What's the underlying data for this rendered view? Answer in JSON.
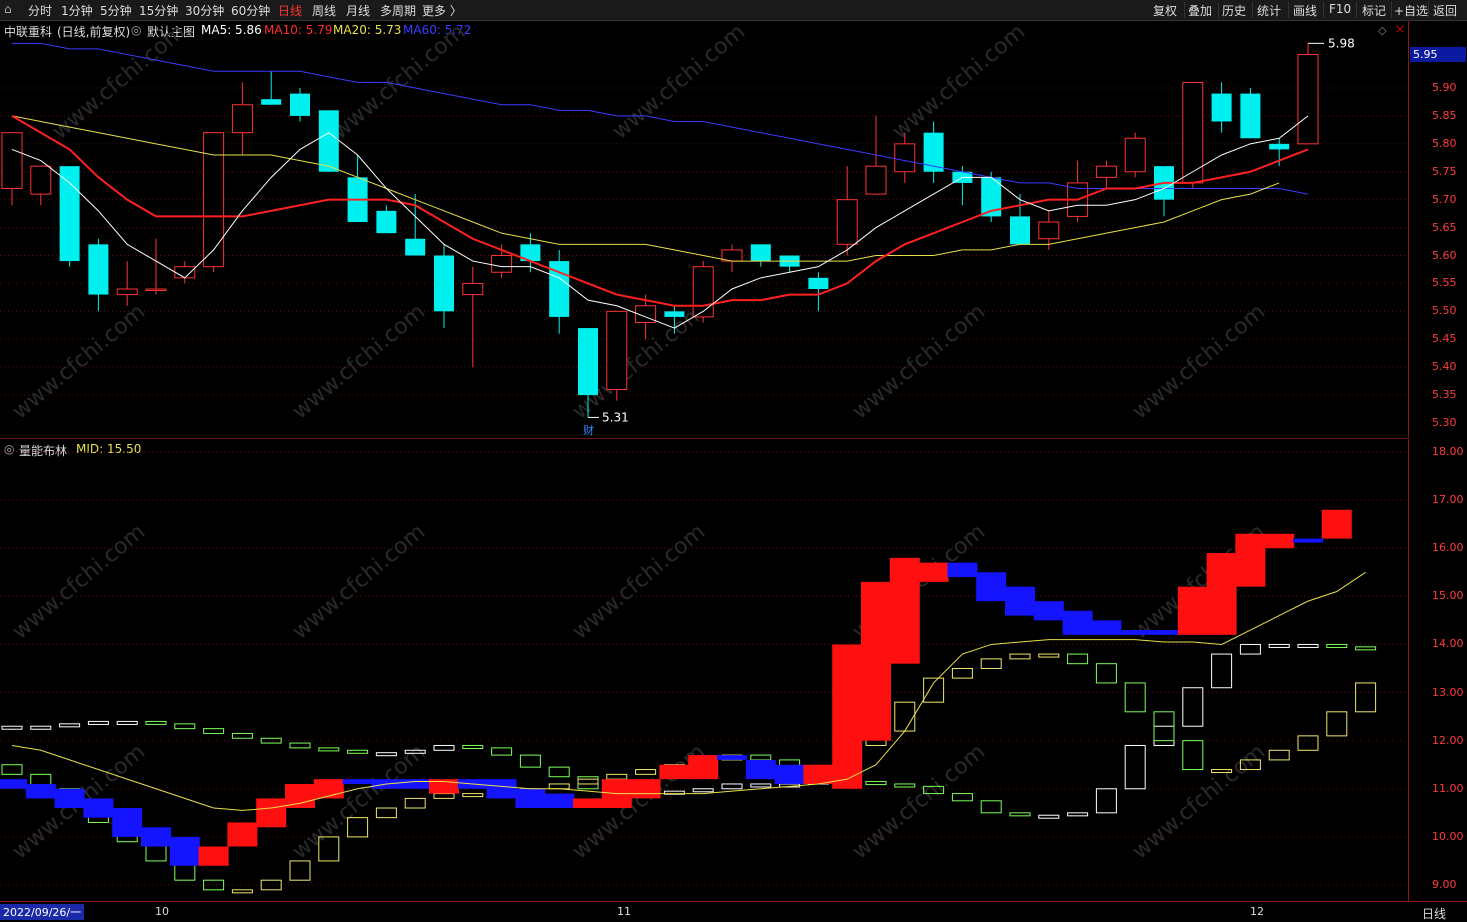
{
  "toolbar": {
    "left_items": [
      "分时",
      "1分钟",
      "5分钟",
      "15分钟",
      "30分钟",
      "60分钟",
      "日线",
      "周线",
      "月线",
      "多周期",
      "更多 〉"
    ],
    "active": "日线",
    "right_items": [
      "复权",
      "叠加",
      "历史",
      "统计",
      "画线",
      "F10",
      "标记",
      "+自选",
      "返回"
    ]
  },
  "main_info": {
    "stock": "中联重科",
    "mode": "(日线,前复权)",
    "template": "默认主图",
    "ma5": "MA5: 5.86",
    "ma10": "MA10: 5.79",
    "ma20": "MA20: 5.73",
    "ma60": "MA60: 5.72",
    "colors": {
      "ma5": "#ffffff",
      "ma10": "#ff2a2a",
      "ma20": "#e8e04a",
      "ma60": "#3b3bff"
    }
  },
  "current_price_tag": "5.95",
  "annotations": {
    "high": "5.98",
    "low": "5.31",
    "badge": "财"
  },
  "price_axis": [
    "5.90",
    "5.85",
    "5.80",
    "5.75",
    "5.70",
    "5.65",
    "5.60",
    "5.55",
    "5.50",
    "5.45",
    "5.40",
    "5.35",
    "5.30"
  ],
  "indicator_info": {
    "name": "量能布林",
    "mid": "MID: 15.50"
  },
  "indicator_axis": [
    "18.00",
    "17.00",
    "16.00",
    "15.00",
    "14.00",
    "13.00",
    "12.00",
    "11.00",
    "10.00",
    "9.00"
  ],
  "date_bar": {
    "start": "2022/09/26/一",
    "m10": "10",
    "m11": "11",
    "m12": "12",
    "period": "日线"
  },
  "candles": [
    {
      "o": 5.72,
      "h": 5.82,
      "l": 5.69,
      "c": 5.82
    },
    {
      "o": 5.71,
      "h": 5.76,
      "l": 5.69,
      "c": 5.76
    },
    {
      "o": 5.76,
      "h": 5.76,
      "l": 5.58,
      "c": 5.59
    },
    {
      "o": 5.62,
      "h": 5.63,
      "l": 5.5,
      "c": 5.53
    },
    {
      "o": 5.53,
      "h": 5.59,
      "l": 5.51,
      "c": 5.54
    },
    {
      "o": 5.54,
      "h": 5.63,
      "l": 5.53,
      "c": 5.54
    },
    {
      "o": 5.56,
      "h": 5.59,
      "l": 5.55,
      "c": 5.58
    },
    {
      "o": 5.58,
      "h": 5.82,
      "l": 5.57,
      "c": 5.82
    },
    {
      "o": 5.82,
      "h": 5.91,
      "l": 5.78,
      "c": 5.87
    },
    {
      "o": 5.88,
      "h": 5.93,
      "l": 5.87,
      "c": 5.87
    },
    {
      "o": 5.89,
      "h": 5.9,
      "l": 5.84,
      "c": 5.85
    },
    {
      "o": 5.86,
      "h": 5.86,
      "l": 5.75,
      "c": 5.75
    },
    {
      "o": 5.74,
      "h": 5.78,
      "l": 5.66,
      "c": 5.66
    },
    {
      "o": 5.68,
      "h": 5.69,
      "l": 5.64,
      "c": 5.64
    },
    {
      "o": 5.63,
      "h": 5.71,
      "l": 5.6,
      "c": 5.6
    },
    {
      "o": 5.6,
      "h": 5.62,
      "l": 5.47,
      "c": 5.5
    },
    {
      "o": 5.53,
      "h": 5.58,
      "l": 5.4,
      "c": 5.55
    },
    {
      "o": 5.57,
      "h": 5.62,
      "l": 5.56,
      "c": 5.6
    },
    {
      "o": 5.62,
      "h": 5.64,
      "l": 5.57,
      "c": 5.59
    },
    {
      "o": 5.59,
      "h": 5.61,
      "l": 5.46,
      "c": 5.49
    },
    {
      "o": 5.47,
      "h": 5.47,
      "l": 5.31,
      "c": 5.35
    },
    {
      "o": 5.36,
      "h": 5.5,
      "l": 5.34,
      "c": 5.5
    },
    {
      "o": 5.48,
      "h": 5.53,
      "l": 5.45,
      "c": 5.51
    },
    {
      "o": 5.5,
      "h": 5.51,
      "l": 5.46,
      "c": 5.49
    },
    {
      "o": 5.49,
      "h": 5.59,
      "l": 5.48,
      "c": 5.58
    },
    {
      "o": 5.59,
      "h": 5.62,
      "l": 5.57,
      "c": 5.61
    },
    {
      "o": 5.62,
      "h": 5.62,
      "l": 5.58,
      "c": 5.59
    },
    {
      "o": 5.6,
      "h": 5.6,
      "l": 5.57,
      "c": 5.58
    },
    {
      "o": 5.56,
      "h": 5.57,
      "l": 5.5,
      "c": 5.54
    },
    {
      "o": 5.62,
      "h": 5.76,
      "l": 5.6,
      "c": 5.7
    },
    {
      "o": 5.71,
      "h": 5.85,
      "l": 5.71,
      "c": 5.76
    },
    {
      "o": 5.75,
      "h": 5.82,
      "l": 5.73,
      "c": 5.8
    },
    {
      "o": 5.82,
      "h": 5.84,
      "l": 5.73,
      "c": 5.75
    },
    {
      "o": 5.75,
      "h": 5.76,
      "l": 5.69,
      "c": 5.73
    },
    {
      "o": 5.74,
      "h": 5.75,
      "l": 5.66,
      "c": 5.67
    },
    {
      "o": 5.67,
      "h": 5.71,
      "l": 5.62,
      "c": 5.62
    },
    {
      "o": 5.63,
      "h": 5.68,
      "l": 5.61,
      "c": 5.66
    },
    {
      "o": 5.67,
      "h": 5.77,
      "l": 5.66,
      "c": 5.73
    },
    {
      "o": 5.74,
      "h": 5.77,
      "l": 5.72,
      "c": 5.76
    },
    {
      "o": 5.75,
      "h": 5.82,
      "l": 5.74,
      "c": 5.81
    },
    {
      "o": 5.76,
      "h": 5.76,
      "l": 5.67,
      "c": 5.7
    },
    {
      "o": 5.73,
      "h": 5.91,
      "l": 5.72,
      "c": 5.91
    },
    {
      "o": 5.89,
      "h": 5.91,
      "l": 5.82,
      "c": 5.84
    },
    {
      "o": 5.89,
      "h": 5.9,
      "l": 5.81,
      "c": 5.81
    },
    {
      "o": 5.8,
      "h": 5.81,
      "l": 5.76,
      "c": 5.79
    },
    {
      "o": 5.8,
      "h": 5.98,
      "l": 5.8,
      "c": 5.96
    }
  ],
  "ma5": [
    5.79,
    5.77,
    5.73,
    5.68,
    5.62,
    5.59,
    5.56,
    5.61,
    5.68,
    5.74,
    5.79,
    5.82,
    5.78,
    5.72,
    5.67,
    5.62,
    5.59,
    5.58,
    5.58,
    5.56,
    5.52,
    5.51,
    5.49,
    5.47,
    5.5,
    5.54,
    5.56,
    5.57,
    5.58,
    5.61,
    5.65,
    5.68,
    5.71,
    5.74,
    5.74,
    5.7,
    5.68,
    5.69,
    5.69,
    5.7,
    5.72,
    5.75,
    5.78,
    5.8,
    5.81,
    5.85
  ],
  "ma10": [
    5.85,
    5.82,
    5.79,
    5.74,
    5.7,
    5.67,
    5.67,
    5.67,
    5.67,
    5.68,
    5.69,
    5.7,
    5.7,
    5.7,
    5.69,
    5.66,
    5.63,
    5.61,
    5.59,
    5.57,
    5.55,
    5.53,
    5.52,
    5.51,
    5.51,
    5.52,
    5.52,
    5.53,
    5.53,
    5.55,
    5.59,
    5.62,
    5.64,
    5.66,
    5.68,
    5.69,
    5.7,
    5.7,
    5.72,
    5.72,
    5.73,
    5.73,
    5.74,
    5.75,
    5.77,
    5.79
  ],
  "ma20": [
    5.85,
    5.84,
    5.83,
    5.82,
    5.81,
    5.8,
    5.79,
    5.78,
    5.78,
    5.78,
    5.77,
    5.76,
    5.74,
    5.72,
    5.7,
    5.68,
    5.66,
    5.64,
    5.63,
    5.62,
    5.62,
    5.62,
    5.62,
    5.61,
    5.6,
    5.59,
    5.59,
    5.59,
    5.59,
    5.59,
    5.6,
    5.6,
    5.6,
    5.61,
    5.61,
    5.62,
    5.62,
    5.63,
    5.64,
    5.65,
    5.66,
    5.68,
    5.7,
    5.71,
    5.73
  ],
  "ma60": [
    5.98,
    5.98,
    5.97,
    5.97,
    5.96,
    5.95,
    5.94,
    5.93,
    5.93,
    5.93,
    5.93,
    5.92,
    5.91,
    5.91,
    5.9,
    5.89,
    5.88,
    5.87,
    5.87,
    5.86,
    5.86,
    5.85,
    5.85,
    5.84,
    5.84,
    5.83,
    5.82,
    5.81,
    5.8,
    5.79,
    5.78,
    5.77,
    5.76,
    5.75,
    5.74,
    5.73,
    5.73,
    5.72,
    5.72,
    5.72,
    5.72,
    5.72,
    5.72,
    5.72,
    5.72,
    5.71
  ],
  "ind_boxes": [
    {
      "a": 11.2,
      "b": 11.0,
      "c": "blue"
    },
    {
      "a": 11.1,
      "b": 10.8,
      "c": "blue"
    },
    {
      "a": 11.0,
      "b": 10.6,
      "c": "blue"
    },
    {
      "a": 10.8,
      "b": 10.4,
      "c": "blue"
    },
    {
      "a": 10.6,
      "b": 10.0,
      "c": "blue"
    },
    {
      "a": 10.2,
      "b": 9.8,
      "c": "blue"
    },
    {
      "a": 10.0,
      "b": 9.4,
      "c": "blue"
    },
    {
      "a": 9.8,
      "b": 9.4,
      "c": "red"
    },
    {
      "a": 9.8,
      "b": 10.3,
      "c": "red"
    },
    {
      "a": 10.2,
      "b": 10.8,
      "c": "red"
    },
    {
      "a": 10.6,
      "b": 11.1,
      "c": "red"
    },
    {
      "a": 10.8,
      "b": 11.2,
      "c": "red"
    },
    {
      "a": 11.2,
      "b": 11.1,
      "c": "blue"
    },
    {
      "a": 11.2,
      "b": 11.0,
      "c": "blue"
    },
    {
      "a": 11.2,
      "b": 11.0,
      "c": "blue"
    },
    {
      "a": 11.2,
      "b": 10.9,
      "c": "red"
    },
    {
      "a": 11.2,
      "b": 11.0,
      "c": "blue"
    },
    {
      "a": 11.2,
      "b": 10.8,
      "c": "blue"
    },
    {
      "a": 11.0,
      "b": 10.6,
      "c": "blue"
    },
    {
      "a": 10.9,
      "b": 10.6,
      "c": "blue"
    },
    {
      "a": 10.6,
      "b": 10.8,
      "c": "red"
    },
    {
      "a": 10.6,
      "b": 11.2,
      "c": "red"
    },
    {
      "a": 10.8,
      "b": 11.2,
      "c": "red"
    },
    {
      "a": 11.2,
      "b": 11.5,
      "c": "red"
    },
    {
      "a": 11.2,
      "b": 11.7,
      "c": "red"
    },
    {
      "a": 11.7,
      "b": 11.6,
      "c": "blue"
    },
    {
      "a": 11.6,
      "b": 11.2,
      "c": "blue"
    },
    {
      "a": 11.5,
      "b": 11.1,
      "c": "blue"
    },
    {
      "a": 11.5,
      "b": 11.1,
      "c": "red"
    },
    {
      "a": 11.0,
      "b": 14.0,
      "c": "red"
    },
    {
      "a": 12.0,
      "b": 15.3,
      "c": "red"
    },
    {
      "a": 13.6,
      "b": 15.8,
      "c": "red"
    },
    {
      "a": 15.3,
      "b": 15.7,
      "c": "red"
    },
    {
      "a": 15.7,
      "b": 15.4,
      "c": "blue"
    },
    {
      "a": 15.5,
      "b": 14.9,
      "c": "blue"
    },
    {
      "a": 15.2,
      "b": 14.6,
      "c": "blue"
    },
    {
      "a": 14.9,
      "b": 14.5,
      "c": "blue"
    },
    {
      "a": 14.7,
      "b": 14.2,
      "c": "blue"
    },
    {
      "a": 14.5,
      "b": 14.2,
      "c": "blue"
    },
    {
      "a": 14.3,
      "b": 14.2,
      "c": "blue"
    },
    {
      "a": 14.3,
      "b": 14.2,
      "c": "blue"
    },
    {
      "a": 14.2,
      "b": 15.2,
      "c": "red"
    },
    {
      "a": 14.2,
      "b": 15.9,
      "c": "red"
    },
    {
      "a": 15.2,
      "b": 16.3,
      "c": "red"
    },
    {
      "a": 16.0,
      "b": 16.3,
      "c": "red"
    },
    {
      "a": 16.2,
      "b": 16.2,
      "c": "blue"
    },
    {
      "a": 16.2,
      "b": 16.8,
      "c": "red"
    }
  ],
  "ind_upper": [
    12.3,
    12.3,
    12.3,
    12.35,
    12.4,
    12.4,
    12.35,
    12.25,
    12.15,
    12.05,
    11.95,
    11.85,
    11.8,
    11.75,
    11.75,
    11.8,
    11.9,
    11.85,
    11.7,
    11.45,
    11.25,
    11.0,
    10.9,
    10.9,
    10.95,
    11.0,
    11.1,
    11.1,
    11.1,
    11.2,
    11.15,
    11.1,
    11.05,
    10.9,
    10.75,
    10.5,
    10.45,
    10.45,
    10.5,
    11.0,
    11.9,
    12.3,
    13.1,
    13.8,
    14.0,
    14.0,
    14.0,
    13.95,
    13.9
  ],
  "ind_lower": [
    11.5,
    11.3,
    11.0,
    10.7,
    10.3,
    9.9,
    9.5,
    9.1,
    8.9,
    8.9,
    9.1,
    9.5,
    10.0,
    10.4,
    10.6,
    10.8,
    10.9,
    10.9,
    10.9,
    11.0,
    11.1,
    11.2,
    11.3,
    11.4,
    11.5,
    11.6,
    11.7,
    11.6,
    11.3,
    11.2,
    11.9,
    12.2,
    12.8,
    13.3,
    13.5,
    13.7,
    13.8,
    13.8,
    13.6,
    13.2,
    12.6,
    12.0,
    11.4,
    11.4,
    11.6,
    11.8,
    12.1,
    12.6,
    13.2
  ],
  "ind_mid": [
    11.9,
    11.8,
    11.6,
    11.4,
    11.2,
    11.0,
    10.8,
    10.6,
    10.55,
    10.6,
    10.7,
    10.85,
    11.0,
    11.1,
    11.15,
    11.15,
    11.1,
    11.05,
    11.0,
    11.0,
    10.95,
    10.9,
    10.9,
    10.9,
    10.9,
    10.95,
    11.0,
    11.05,
    11.1,
    11.2,
    11.5,
    12.2,
    13.2,
    13.8,
    14.0,
    14.05,
    14.1,
    14.1,
    14.1,
    14.1,
    14.05,
    14.05,
    14.0,
    14.3,
    14.6,
    14.9,
    15.1,
    15.5
  ]
}
